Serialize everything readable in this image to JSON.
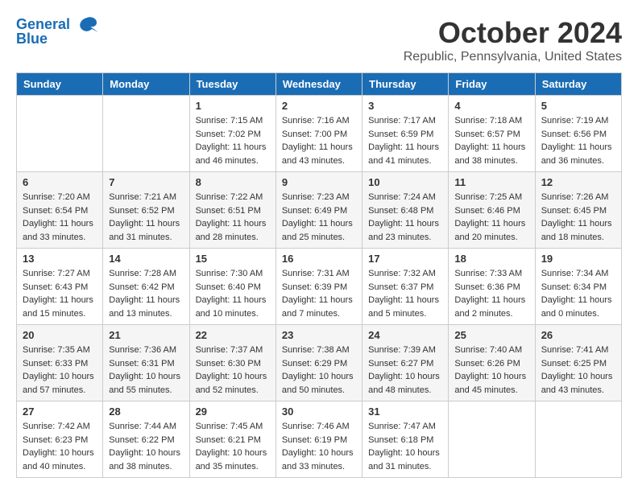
{
  "header": {
    "logo_line1": "General",
    "logo_line2": "Blue",
    "month_title": "October 2024",
    "location": "Republic, Pennsylvania, United States"
  },
  "weekdays": [
    "Sunday",
    "Monday",
    "Tuesday",
    "Wednesday",
    "Thursday",
    "Friday",
    "Saturday"
  ],
  "weeks": [
    [
      {
        "day": "",
        "sunrise": "",
        "sunset": "",
        "daylight": ""
      },
      {
        "day": "",
        "sunrise": "",
        "sunset": "",
        "daylight": ""
      },
      {
        "day": "1",
        "sunrise": "Sunrise: 7:15 AM",
        "sunset": "Sunset: 7:02 PM",
        "daylight": "Daylight: 11 hours and 46 minutes."
      },
      {
        "day": "2",
        "sunrise": "Sunrise: 7:16 AM",
        "sunset": "Sunset: 7:00 PM",
        "daylight": "Daylight: 11 hours and 43 minutes."
      },
      {
        "day": "3",
        "sunrise": "Sunrise: 7:17 AM",
        "sunset": "Sunset: 6:59 PM",
        "daylight": "Daylight: 11 hours and 41 minutes."
      },
      {
        "day": "4",
        "sunrise": "Sunrise: 7:18 AM",
        "sunset": "Sunset: 6:57 PM",
        "daylight": "Daylight: 11 hours and 38 minutes."
      },
      {
        "day": "5",
        "sunrise": "Sunrise: 7:19 AM",
        "sunset": "Sunset: 6:56 PM",
        "daylight": "Daylight: 11 hours and 36 minutes."
      }
    ],
    [
      {
        "day": "6",
        "sunrise": "Sunrise: 7:20 AM",
        "sunset": "Sunset: 6:54 PM",
        "daylight": "Daylight: 11 hours and 33 minutes."
      },
      {
        "day": "7",
        "sunrise": "Sunrise: 7:21 AM",
        "sunset": "Sunset: 6:52 PM",
        "daylight": "Daylight: 11 hours and 31 minutes."
      },
      {
        "day": "8",
        "sunrise": "Sunrise: 7:22 AM",
        "sunset": "Sunset: 6:51 PM",
        "daylight": "Daylight: 11 hours and 28 minutes."
      },
      {
        "day": "9",
        "sunrise": "Sunrise: 7:23 AM",
        "sunset": "Sunset: 6:49 PM",
        "daylight": "Daylight: 11 hours and 25 minutes."
      },
      {
        "day": "10",
        "sunrise": "Sunrise: 7:24 AM",
        "sunset": "Sunset: 6:48 PM",
        "daylight": "Daylight: 11 hours and 23 minutes."
      },
      {
        "day": "11",
        "sunrise": "Sunrise: 7:25 AM",
        "sunset": "Sunset: 6:46 PM",
        "daylight": "Daylight: 11 hours and 20 minutes."
      },
      {
        "day": "12",
        "sunrise": "Sunrise: 7:26 AM",
        "sunset": "Sunset: 6:45 PM",
        "daylight": "Daylight: 11 hours and 18 minutes."
      }
    ],
    [
      {
        "day": "13",
        "sunrise": "Sunrise: 7:27 AM",
        "sunset": "Sunset: 6:43 PM",
        "daylight": "Daylight: 11 hours and 15 minutes."
      },
      {
        "day": "14",
        "sunrise": "Sunrise: 7:28 AM",
        "sunset": "Sunset: 6:42 PM",
        "daylight": "Daylight: 11 hours and 13 minutes."
      },
      {
        "day": "15",
        "sunrise": "Sunrise: 7:30 AM",
        "sunset": "Sunset: 6:40 PM",
        "daylight": "Daylight: 11 hours and 10 minutes."
      },
      {
        "day": "16",
        "sunrise": "Sunrise: 7:31 AM",
        "sunset": "Sunset: 6:39 PM",
        "daylight": "Daylight: 11 hours and 7 minutes."
      },
      {
        "day": "17",
        "sunrise": "Sunrise: 7:32 AM",
        "sunset": "Sunset: 6:37 PM",
        "daylight": "Daylight: 11 hours and 5 minutes."
      },
      {
        "day": "18",
        "sunrise": "Sunrise: 7:33 AM",
        "sunset": "Sunset: 6:36 PM",
        "daylight": "Daylight: 11 hours and 2 minutes."
      },
      {
        "day": "19",
        "sunrise": "Sunrise: 7:34 AM",
        "sunset": "Sunset: 6:34 PM",
        "daylight": "Daylight: 11 hours and 0 minutes."
      }
    ],
    [
      {
        "day": "20",
        "sunrise": "Sunrise: 7:35 AM",
        "sunset": "Sunset: 6:33 PM",
        "daylight": "Daylight: 10 hours and 57 minutes."
      },
      {
        "day": "21",
        "sunrise": "Sunrise: 7:36 AM",
        "sunset": "Sunset: 6:31 PM",
        "daylight": "Daylight: 10 hours and 55 minutes."
      },
      {
        "day": "22",
        "sunrise": "Sunrise: 7:37 AM",
        "sunset": "Sunset: 6:30 PM",
        "daylight": "Daylight: 10 hours and 52 minutes."
      },
      {
        "day": "23",
        "sunrise": "Sunrise: 7:38 AM",
        "sunset": "Sunset: 6:29 PM",
        "daylight": "Daylight: 10 hours and 50 minutes."
      },
      {
        "day": "24",
        "sunrise": "Sunrise: 7:39 AM",
        "sunset": "Sunset: 6:27 PM",
        "daylight": "Daylight: 10 hours and 48 minutes."
      },
      {
        "day": "25",
        "sunrise": "Sunrise: 7:40 AM",
        "sunset": "Sunset: 6:26 PM",
        "daylight": "Daylight: 10 hours and 45 minutes."
      },
      {
        "day": "26",
        "sunrise": "Sunrise: 7:41 AM",
        "sunset": "Sunset: 6:25 PM",
        "daylight": "Daylight: 10 hours and 43 minutes."
      }
    ],
    [
      {
        "day": "27",
        "sunrise": "Sunrise: 7:42 AM",
        "sunset": "Sunset: 6:23 PM",
        "daylight": "Daylight: 10 hours and 40 minutes."
      },
      {
        "day": "28",
        "sunrise": "Sunrise: 7:44 AM",
        "sunset": "Sunset: 6:22 PM",
        "daylight": "Daylight: 10 hours and 38 minutes."
      },
      {
        "day": "29",
        "sunrise": "Sunrise: 7:45 AM",
        "sunset": "Sunset: 6:21 PM",
        "daylight": "Daylight: 10 hours and 35 minutes."
      },
      {
        "day": "30",
        "sunrise": "Sunrise: 7:46 AM",
        "sunset": "Sunset: 6:19 PM",
        "daylight": "Daylight: 10 hours and 33 minutes."
      },
      {
        "day": "31",
        "sunrise": "Sunrise: 7:47 AM",
        "sunset": "Sunset: 6:18 PM",
        "daylight": "Daylight: 10 hours and 31 minutes."
      },
      {
        "day": "",
        "sunrise": "",
        "sunset": "",
        "daylight": ""
      },
      {
        "day": "",
        "sunrise": "",
        "sunset": "",
        "daylight": ""
      }
    ]
  ]
}
